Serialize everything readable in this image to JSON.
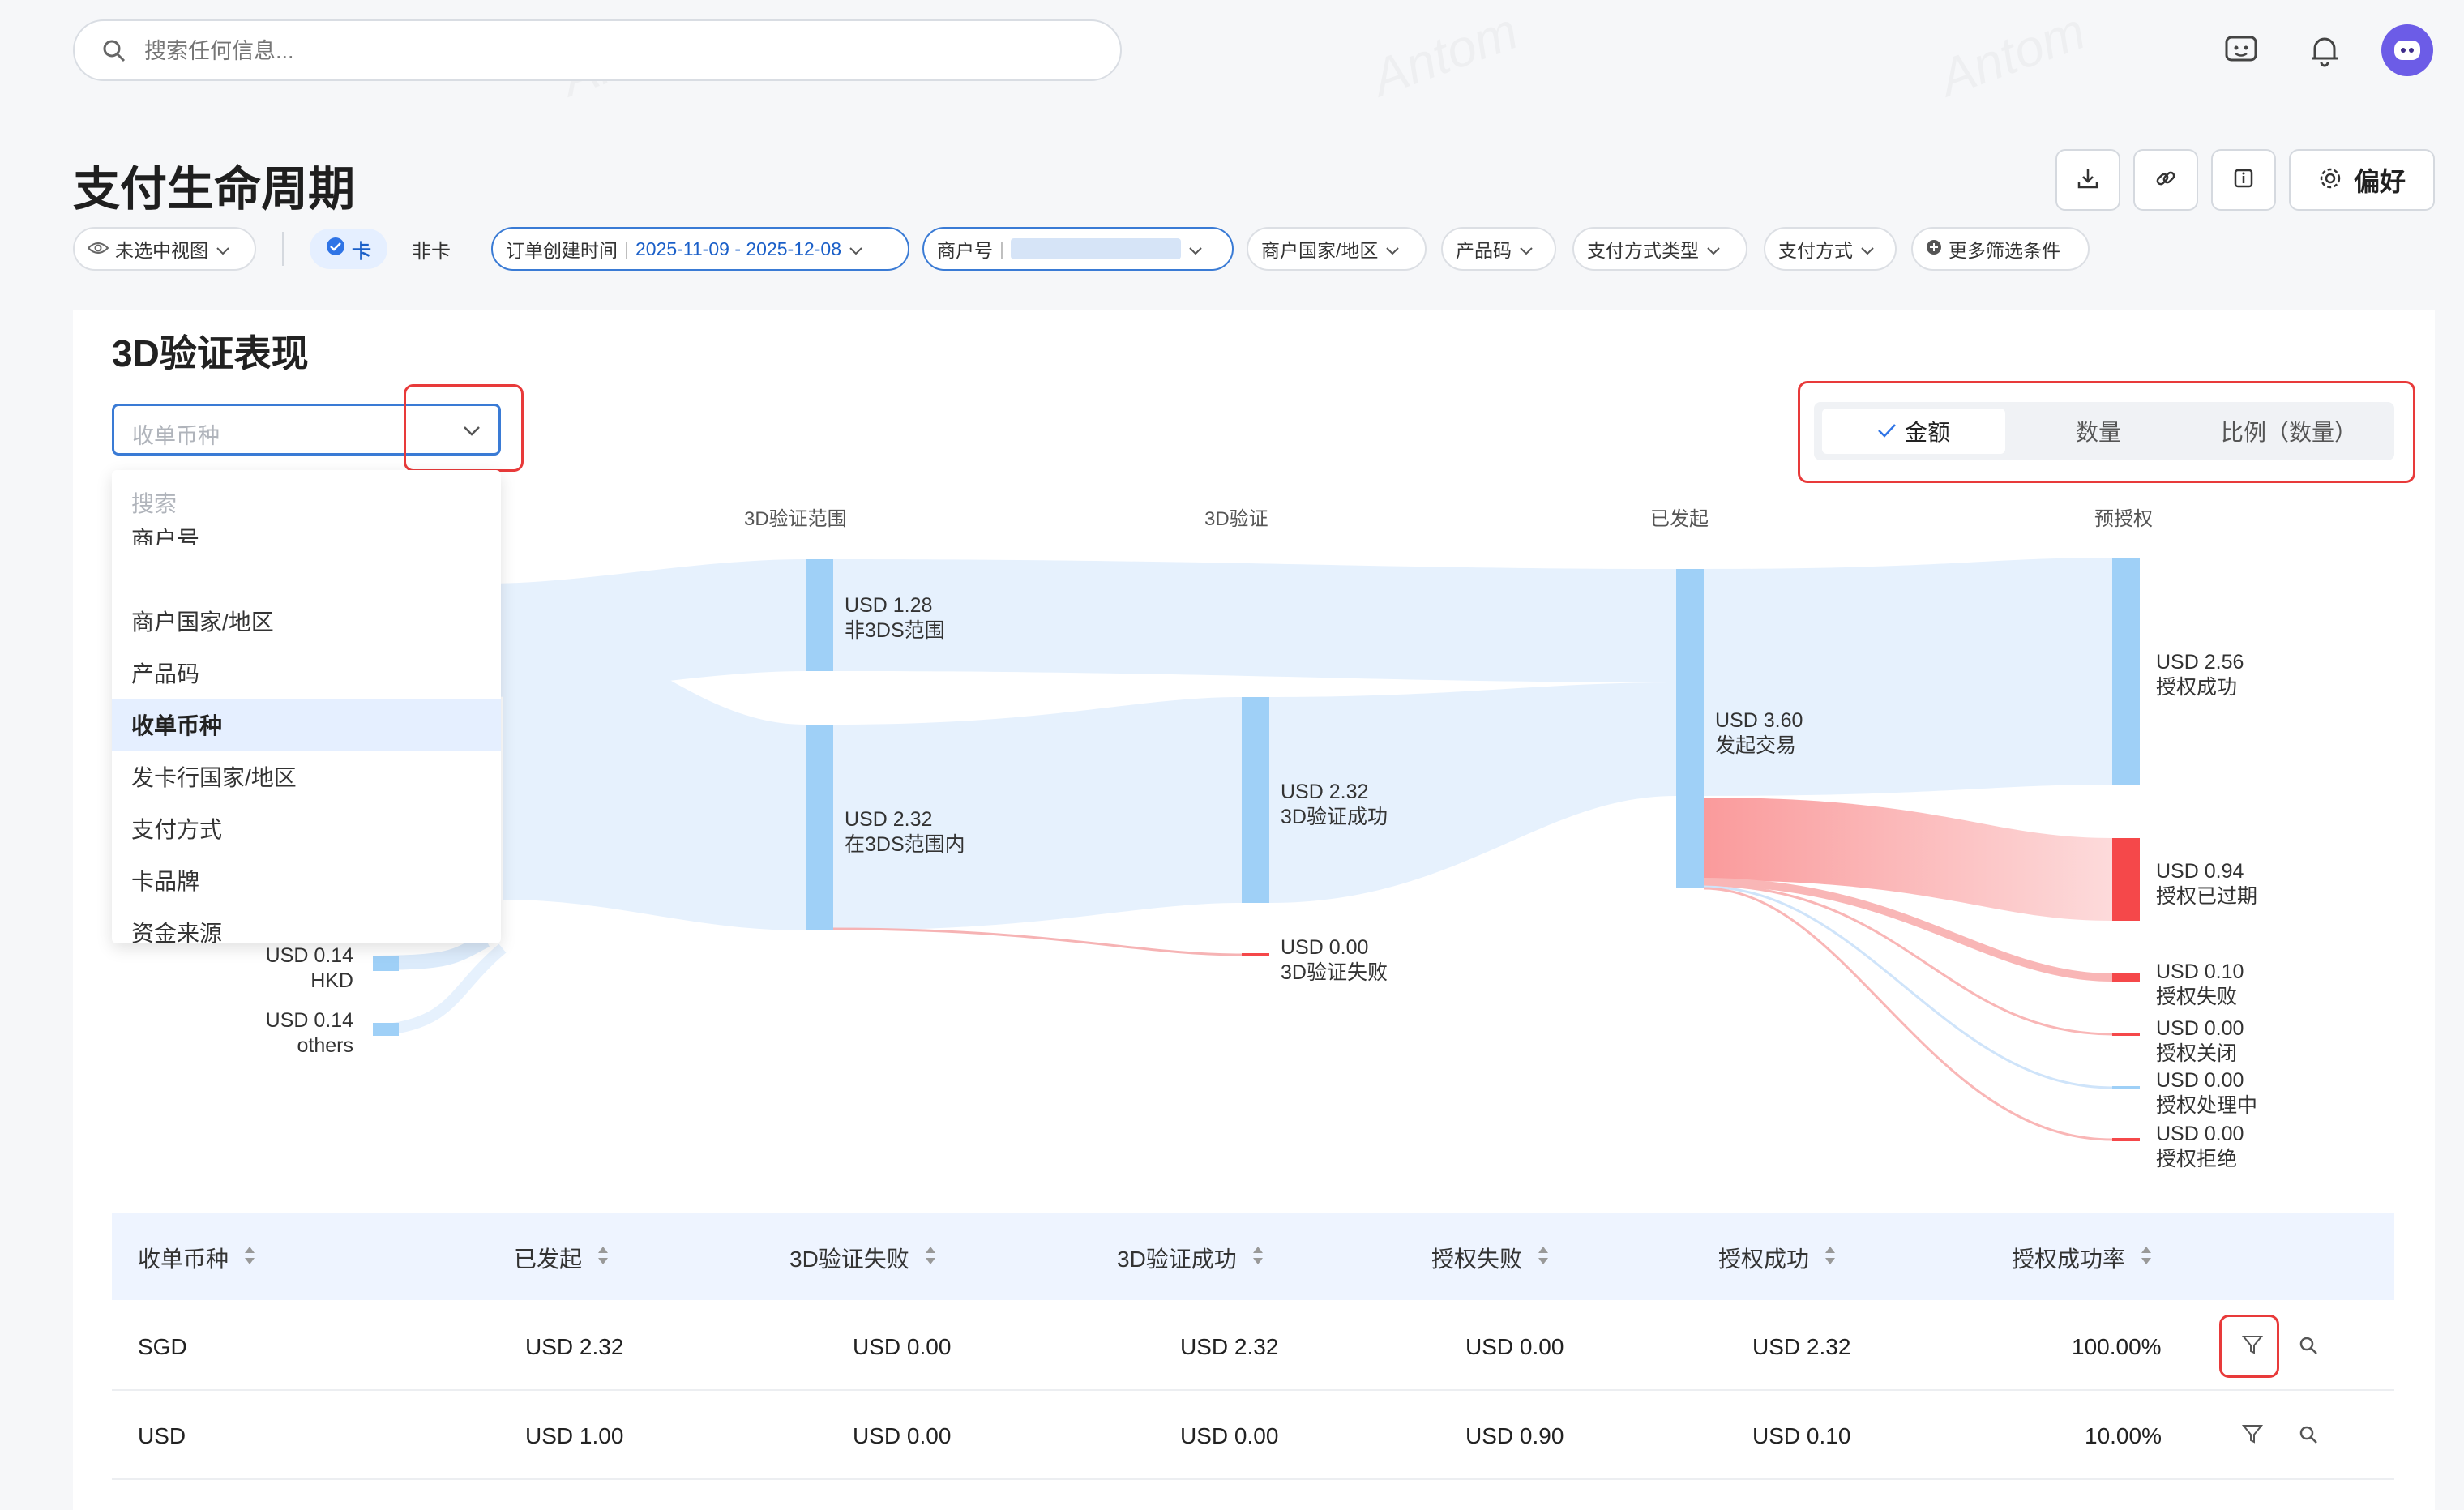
{
  "header": {
    "search_placeholder": "搜索任何信息..."
  },
  "page": {
    "title": "支付生命周期",
    "toolbar": {
      "prefs_label": "偏好"
    }
  },
  "filters": {
    "view_label": "未选中视图",
    "card_label": "卡",
    "noncard_label": "非卡",
    "order_time_label": "订单创建时间",
    "order_time_value": "2025-11-09 - 2025-12-08",
    "merchant_label": "商户号",
    "merchant_country_label": "商户国家/地区",
    "product_code_label": "产品码",
    "payment_type_label": "支付方式类型",
    "payment_method_label": "支付方式",
    "more_label": "更多筛选条件"
  },
  "section": {
    "title": "3D验证表现",
    "dimension_placeholder": "收单币种",
    "segmented": [
      {
        "label": "金额",
        "active": true
      },
      {
        "label": "数量",
        "active": false
      },
      {
        "label": "比例（数量）",
        "active": false
      }
    ]
  },
  "dropdown": {
    "search_placeholder": "搜索",
    "partial_item": "商户号",
    "items": [
      {
        "label": "商户国家/地区",
        "active": false
      },
      {
        "label": "产品码",
        "active": false
      },
      {
        "label": "收单币种",
        "active": true
      },
      {
        "label": "发卡行国家/地区",
        "active": false
      },
      {
        "label": "支付方式",
        "active": false
      },
      {
        "label": "卡品牌",
        "active": false
      },
      {
        "label": "资金来源",
        "active": false
      }
    ]
  },
  "sankey": {
    "columns": [
      "3D验证范围",
      "3D验证",
      "已发起",
      "预授权"
    ],
    "nodes": {
      "hkd": {
        "value": "USD 0.14",
        "name": "HKD"
      },
      "others": {
        "value": "USD 0.14",
        "name": "others"
      },
      "non3ds": {
        "value": "USD 1.28",
        "name": "非3DS范围"
      },
      "in3ds": {
        "value": "USD 2.32",
        "name": "在3DS范围内"
      },
      "v_success": {
        "value": "USD 2.32",
        "name": "3D验证成功"
      },
      "v_fail": {
        "value": "USD 0.00",
        "name": "3D验证失败"
      },
      "initiated": {
        "value": "USD 3.60",
        "name": "发起交易"
      },
      "auth_success": {
        "value": "USD 2.56",
        "name": "授权成功"
      },
      "auth_expired": {
        "value": "USD 0.94",
        "name": "授权已过期"
      },
      "auth_fail": {
        "value": "USD 0.10",
        "name": "授权失败"
      },
      "auth_closed": {
        "value": "USD 0.00",
        "name": "授权关闭"
      },
      "auth_processing": {
        "value": "USD 0.00",
        "name": "授权处理中"
      },
      "auth_rejected": {
        "value": "USD 0.00",
        "name": "授权拒绝"
      }
    }
  },
  "table": {
    "headers": [
      "收单币种",
      "已发起",
      "3D验证失败",
      "3D验证成功",
      "授权失败",
      "授权成功",
      "授权成功率"
    ],
    "rows": [
      [
        "SGD",
        "USD 2.32",
        "USD 0.00",
        "USD 2.32",
        "USD 0.00",
        "USD 2.32",
        "100.00%"
      ],
      [
        "USD",
        "USD 1.00",
        "USD 0.00",
        "USD 0.00",
        "USD 0.90",
        "USD 0.10",
        "10.00%"
      ]
    ]
  },
  "colors": {
    "primary": "#3a7bd5",
    "flow_blue": "#e6f1fd",
    "node_blue": "#9fd0f7",
    "node_red": "#f5484a",
    "highlight_red": "#e83a3a"
  }
}
